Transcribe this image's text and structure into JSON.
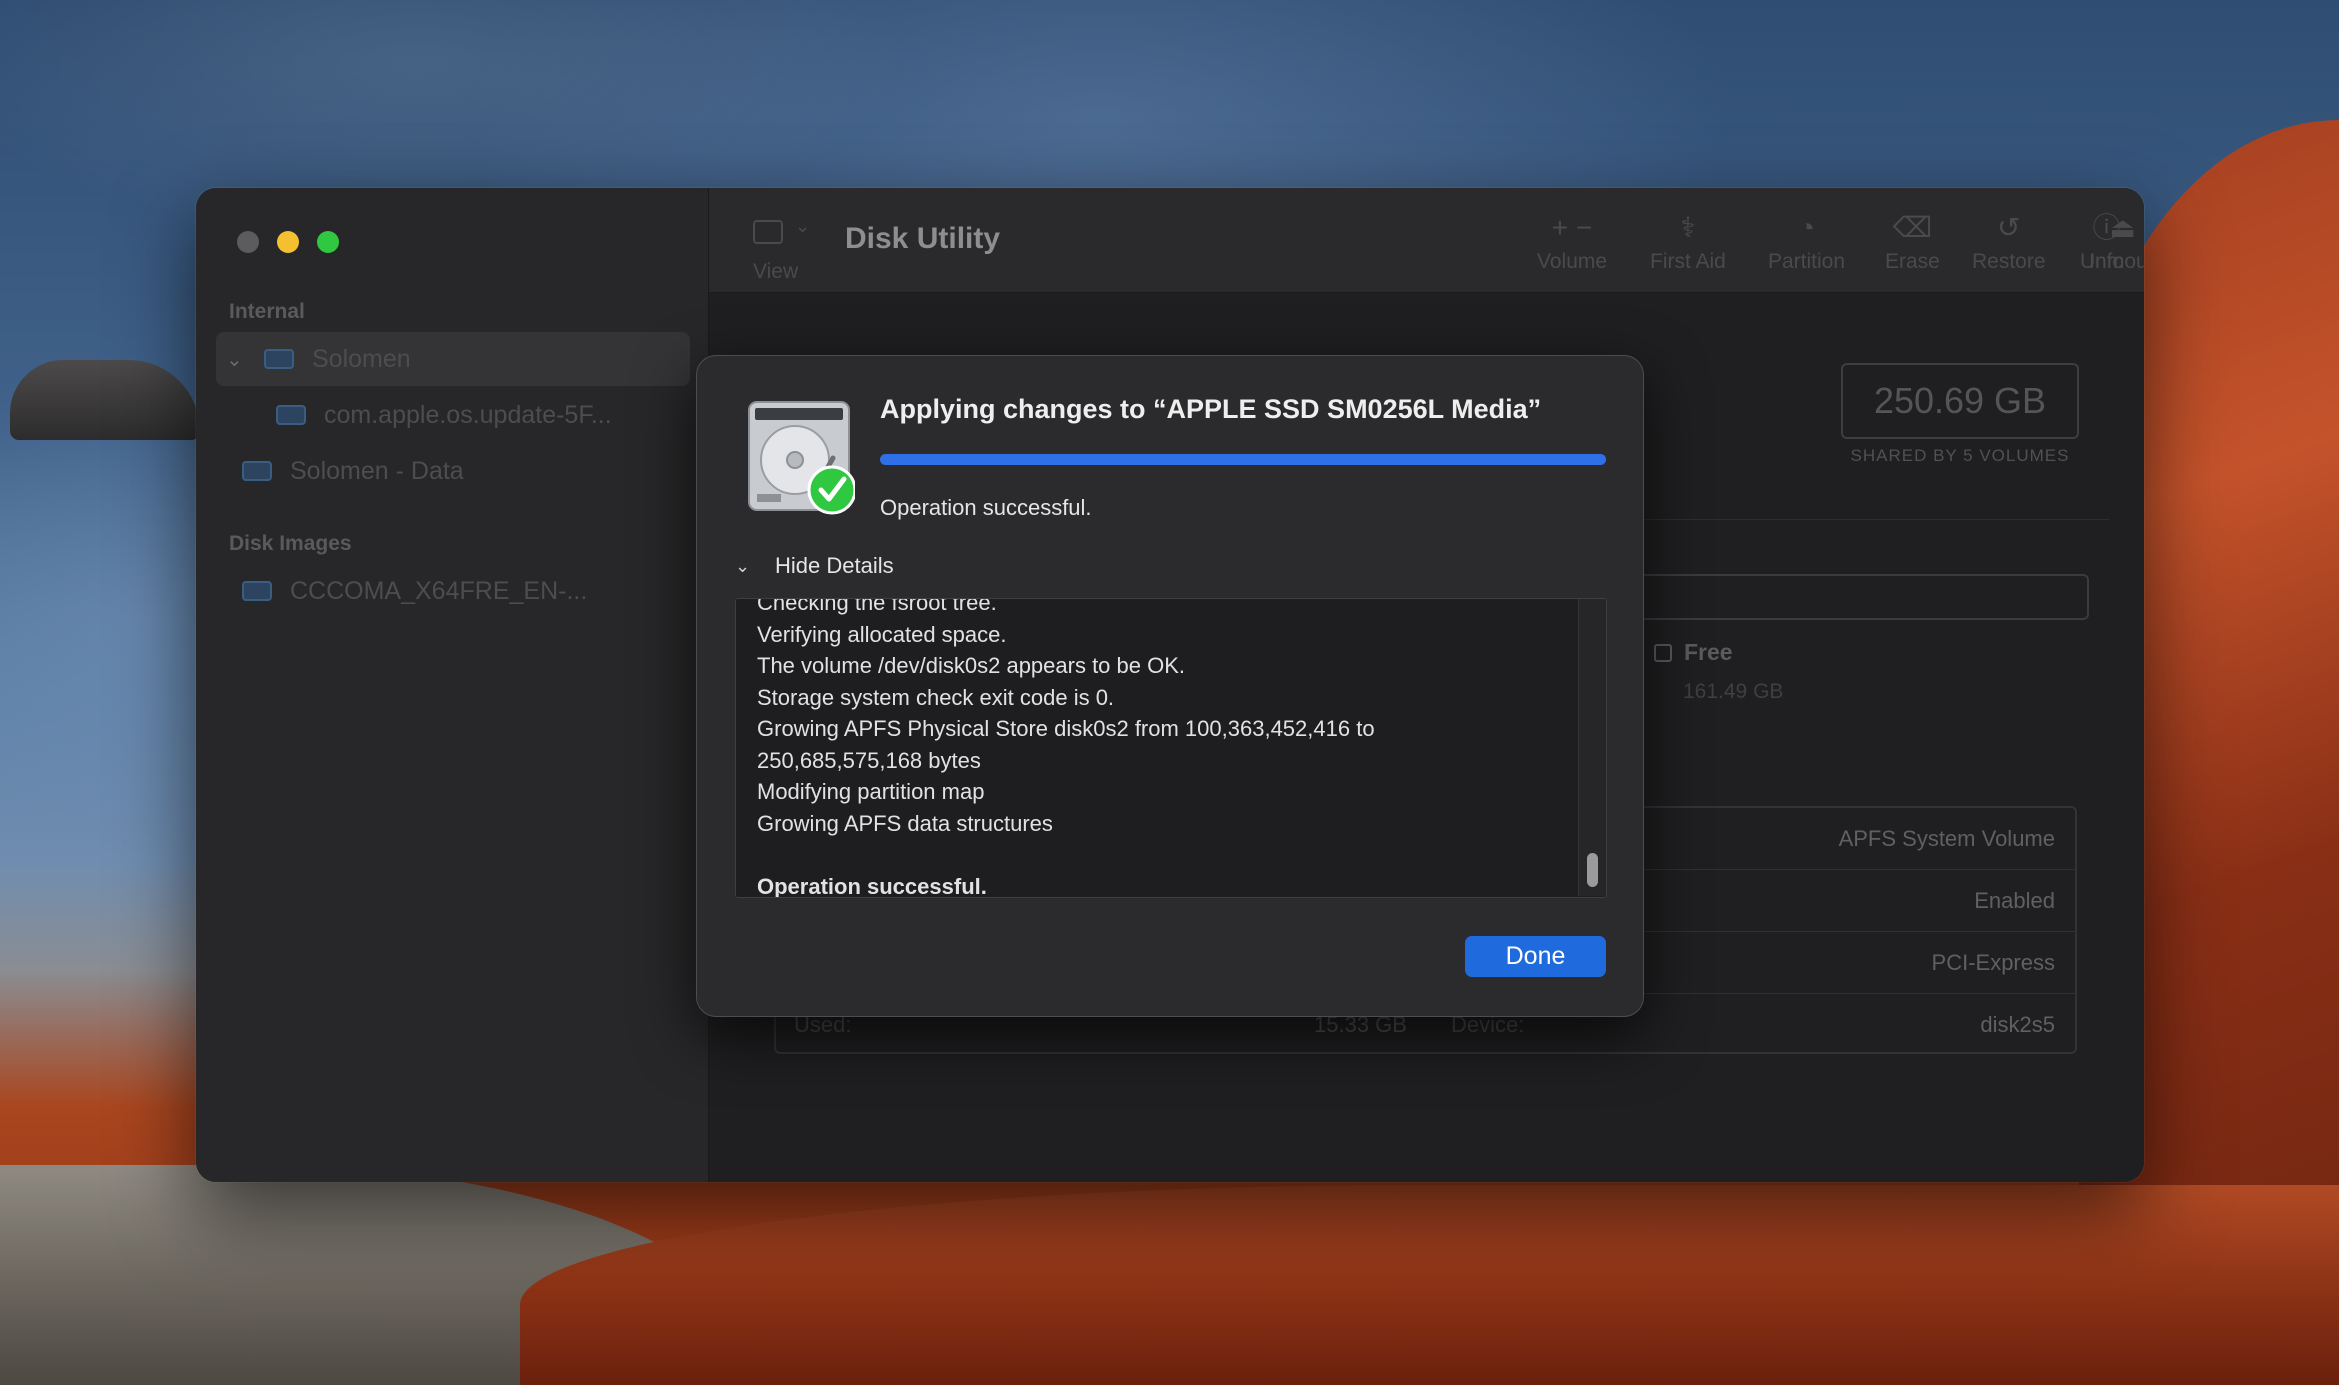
{
  "app": {
    "title": "Disk Utility"
  },
  "sidebar": {
    "sections": [
      {
        "label": "Internal"
      },
      {
        "label": "Disk Images"
      }
    ],
    "items": [
      {
        "label": "Solomen"
      },
      {
        "label": "com.apple.os.update-5F..."
      },
      {
        "label": "Solomen - Data"
      },
      {
        "label": "CCCOMA_X64FRE_EN-..."
      }
    ]
  },
  "toolbar": {
    "view_label": "View",
    "buttons": [
      {
        "label": "Volume",
        "icon": "plus-minus-icon"
      },
      {
        "label": "First Aid",
        "icon": "stethoscope-icon"
      },
      {
        "label": "Partition",
        "icon": "pie-icon"
      },
      {
        "label": "Erase",
        "icon": "eraser-icon"
      },
      {
        "label": "Restore",
        "icon": "restore-icon"
      },
      {
        "label": "Unmount",
        "icon": "eject-icon"
      },
      {
        "label": "Info",
        "icon": "info-icon"
      }
    ]
  },
  "main": {
    "capacity": "250.69 GB",
    "capacity_sub": "SHARED BY 5 VOLUMES",
    "free_label": "Free",
    "free_value": "161.49 GB",
    "info_rows": [
      {
        "right": "APFS System Volume"
      },
      {
        "right": "Enabled"
      },
      {
        "right": "PCI-Express"
      },
      {
        "left_label": "Used:",
        "left_value": "15.33 GB",
        "mid_label": "Device:",
        "right": "disk2s5"
      }
    ]
  },
  "dialog": {
    "title": "Applying changes to “APPLE SSD SM0256L Media”",
    "progress": 1.0,
    "status": "Operation successful.",
    "details_toggle": "Hide Details",
    "log_lines": [
      {
        "text": "Checking the fsroot tree.",
        "bold": false
      },
      {
        "text": "Verifying allocated space.",
        "bold": false
      },
      {
        "text": "The volume /dev/disk0s2 appears to be OK.",
        "bold": false
      },
      {
        "text": "Storage system check exit code is 0.",
        "bold": false
      },
      {
        "text": "Growing APFS Physical Store disk0s2 from 100,363,452,416 to",
        "bold": false
      },
      {
        "text": "250,685,575,168 bytes",
        "bold": false
      },
      {
        "text": "Modifying partition map",
        "bold": false
      },
      {
        "text": "Growing APFS data structures",
        "bold": false
      },
      {
        "text": "",
        "bold": false
      },
      {
        "text": "Operation successful.",
        "bold": true
      }
    ],
    "done_label": "Done"
  },
  "colors": {
    "accent": "#1f6bde",
    "progress": "#2f6fe8",
    "success": "#2fc840"
  }
}
